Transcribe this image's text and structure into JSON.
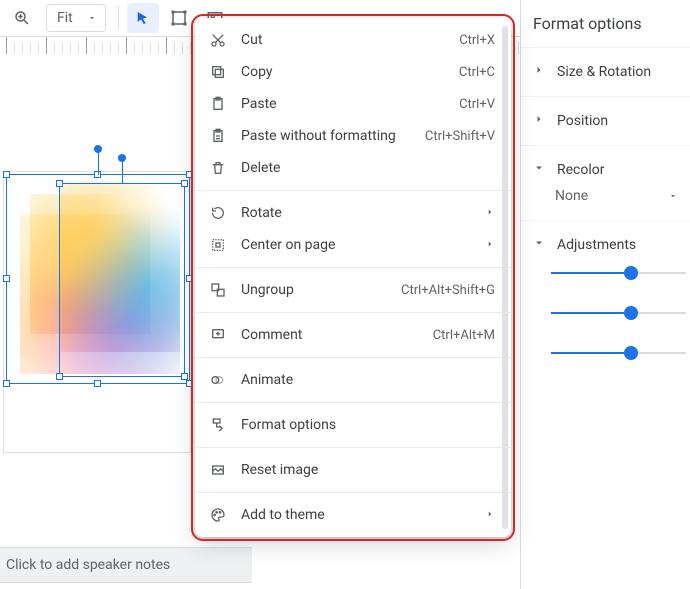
{
  "toolbar": {
    "zoom_value": "Fit"
  },
  "sidebar": {
    "title": "Format options",
    "sections": {
      "size_rotation": "Size & Rotation",
      "position": "Position",
      "recolor": "Recolor",
      "none": "None",
      "adjustments": "Adjustments"
    }
  },
  "notes": {
    "placeholder": "Click to add speaker notes"
  },
  "context_menu": {
    "cut": {
      "label": "Cut",
      "accel": "Ctrl+X"
    },
    "copy": {
      "label": "Copy",
      "accel": "Ctrl+C"
    },
    "paste": {
      "label": "Paste",
      "accel": "Ctrl+V"
    },
    "paste_plain": {
      "label": "Paste without formatting",
      "accel": "Ctrl+Shift+V"
    },
    "delete": {
      "label": "Delete"
    },
    "rotate": {
      "label": "Rotate"
    },
    "center": {
      "label": "Center on page"
    },
    "ungroup": {
      "label": "Ungroup",
      "accel": "Ctrl+Alt+Shift+G"
    },
    "comment": {
      "label": "Comment",
      "accel": "Ctrl+Alt+M"
    },
    "animate": {
      "label": "Animate"
    },
    "format_options": {
      "label": "Format options"
    },
    "reset_image": {
      "label": "Reset image"
    },
    "add_to_theme": {
      "label": "Add to theme"
    }
  }
}
